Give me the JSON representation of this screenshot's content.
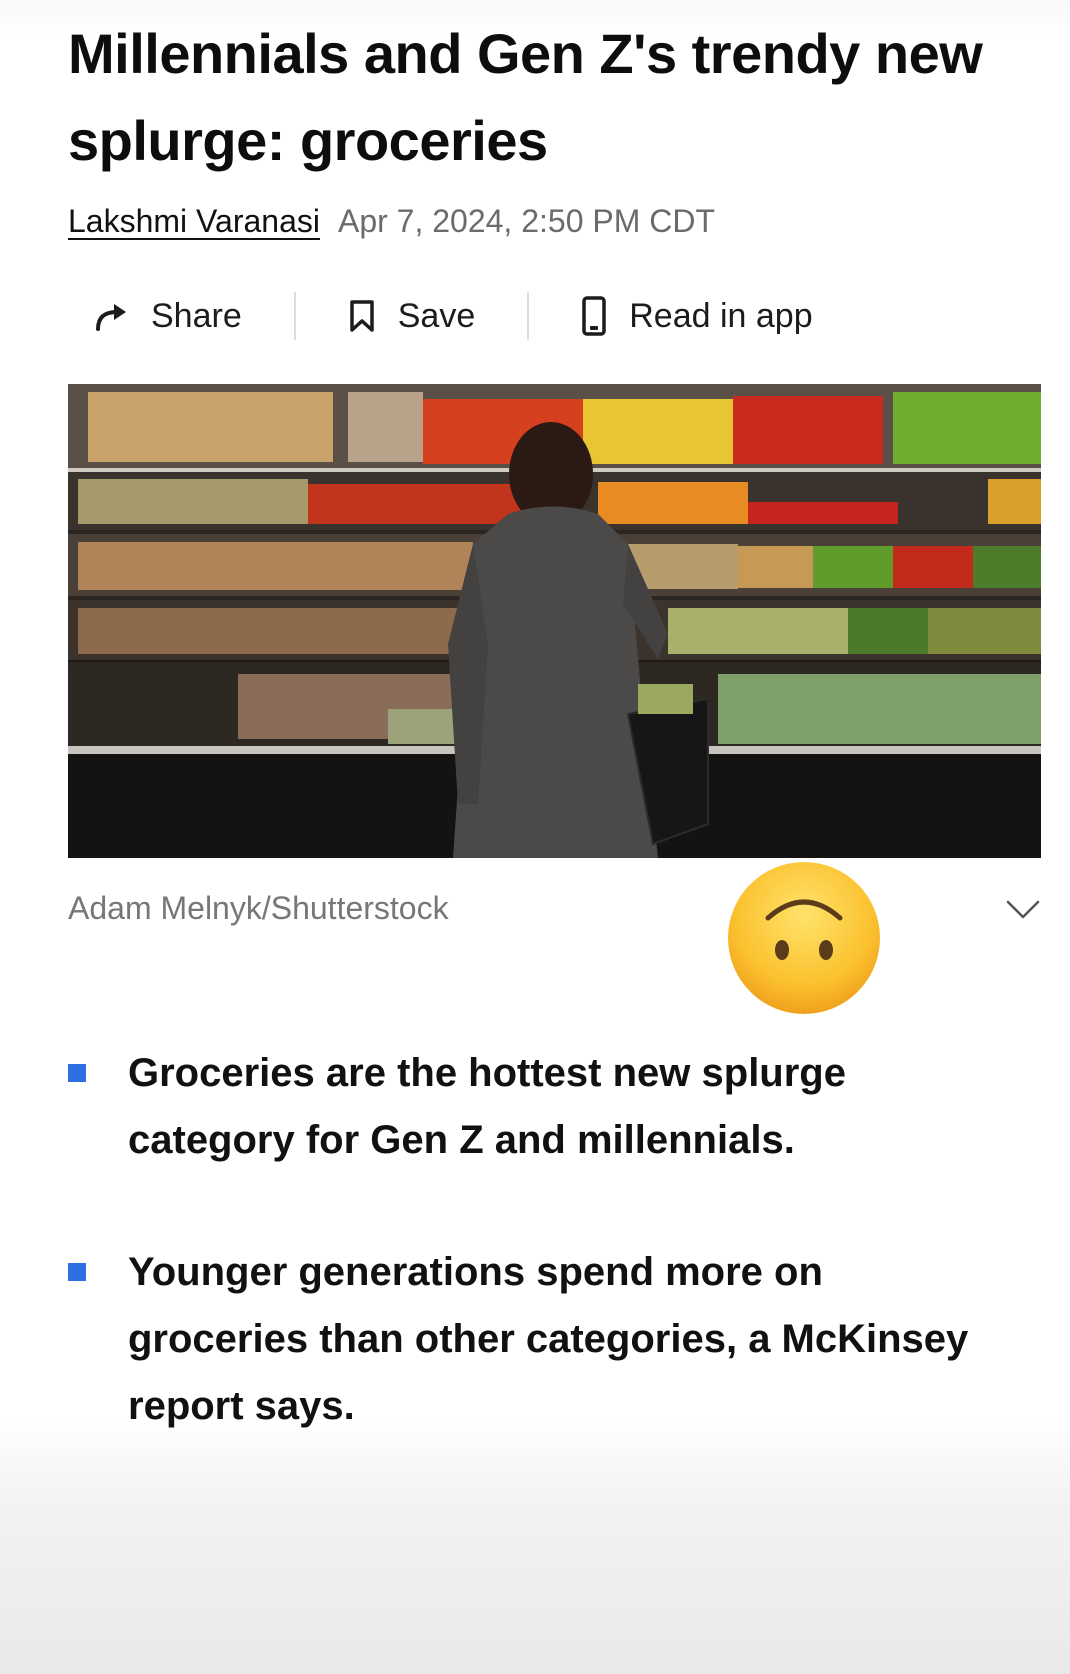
{
  "article": {
    "headline": "Millennials and Gen Z's trendy new splurge: groceries",
    "author": "Lakshmi Varanasi",
    "date": "Apr 7, 2024, 2:50 PM CDT"
  },
  "actions": [
    {
      "label": "Share",
      "icon": "share-arrow-icon"
    },
    {
      "label": "Save",
      "icon": "bookmark-icon"
    },
    {
      "label": "Read in app",
      "icon": "phone-icon"
    }
  ],
  "image": {
    "alt_subject": "woman with basket in front of grocery produce shelves",
    "caption": "Adam Melnyk/Shutterstock"
  },
  "overlay": {
    "emoji": "upside-down-face-emoji"
  },
  "bullets": [
    "Groceries are the hottest new splurge category for Gen Z and millennials.",
    "Younger generations spend more on groceries than other categories, a McKinsey report says."
  ],
  "colors": {
    "bullet_accent": "#2e6fe4",
    "text": "#111111",
    "muted": "#6b6b6b"
  }
}
